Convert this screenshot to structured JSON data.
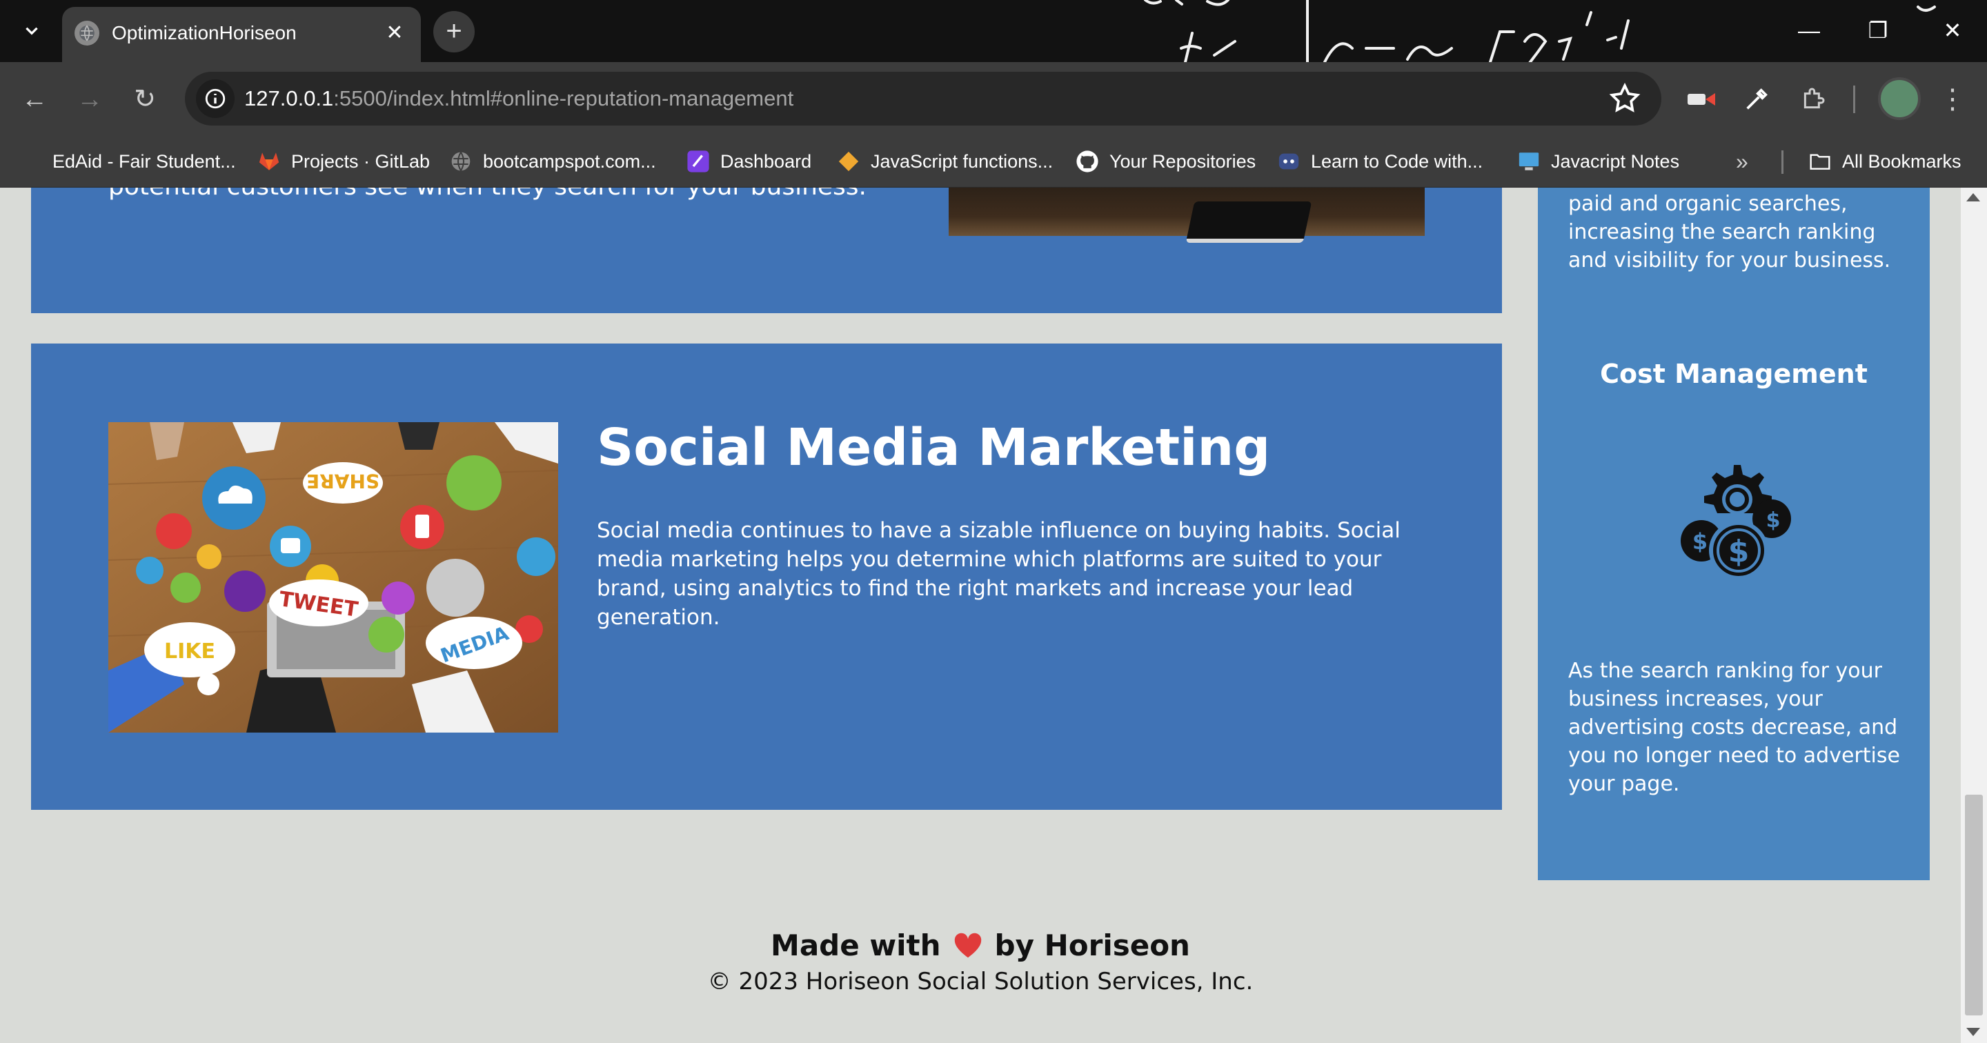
{
  "browser": {
    "tab": {
      "title": "OptimizationHoriseon"
    },
    "url": {
      "host": "127.0.0.1",
      "rest": ":5500/index.html#online-reputation-management"
    },
    "bookmarks": [
      {
        "label": "EdAid - Fair Student...",
        "icon": "edaid-icon"
      },
      {
        "label": "Projects · GitLab",
        "icon": "gitlab-icon"
      },
      {
        "label": "bootcampspot.com...",
        "icon": "globe-icon"
      },
      {
        "label": "Dashboard",
        "icon": "pen-icon"
      },
      {
        "label": "JavaScript functions...",
        "icon": "diamond-icon"
      },
      {
        "label": "Your Repositories",
        "icon": "github-icon"
      },
      {
        "label": "Learn to Code with...",
        "icon": "robot-icon"
      },
      {
        "label": "Javacript Notes",
        "icon": "monitor-icon"
      }
    ],
    "all_bookmarks": "All Bookmarks"
  },
  "page": {
    "prev_card_text": "potential customers see when they search for your business.",
    "smm": {
      "title": "Social Media Marketing",
      "body": "Social media continues to have a sizable influence on buying habits. Social media marketing helps you determine which platforms are suited to your brand, using analytics to find the right markets and increase your lead generation.",
      "image_bubbles": [
        "SHARE",
        "TWEET",
        "LIKE",
        "MEDIA"
      ]
    },
    "aside": {
      "top_text": "Users find your business through paid and organic searches, increasing the search ranking and visibility for your business.",
      "title": "Cost Management",
      "body": "As the search ranking for your business increases, your advertising costs decrease, and you no longer need to advertise your page."
    },
    "footer": {
      "made_with": "Made with",
      "by": "by Horiseon",
      "copyright": "© 2023 Horiseon Social Solution Services, Inc."
    }
  },
  "colors": {
    "card_blue": "#4073b6",
    "aside_blue": "#4a86c0",
    "page_bg": "#d9dbd7",
    "heart": "#e03b3b"
  }
}
